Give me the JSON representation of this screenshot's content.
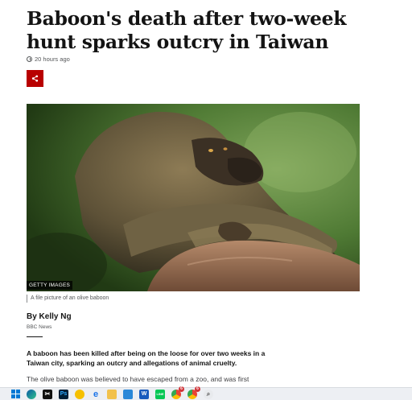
{
  "article": {
    "headline": "Baboon's death after two-week hunt sparks outcry in Taiwan",
    "timestamp": "20 hours ago",
    "share_icon": "share-icon",
    "image": {
      "credit": "GETTY IMAGES",
      "caption": "A file picture of an olive baboon"
    },
    "byline": {
      "author": "By Kelly Ng",
      "organization": "BBC News"
    },
    "lead_paragraph": "A baboon has been killed after being on the loose for over two weeks in a Taiwan city, sparking an outcry and allegations of animal cruelty.",
    "paragraph_2": "The olive baboon was believed to have escaped from a zoo, and was first"
  },
  "colors": {
    "brand_red": "#b80000",
    "text": "#141414",
    "muted": "#545658"
  },
  "taskbar": {
    "icons": [
      {
        "name": "windows-start-icon",
        "label": ""
      },
      {
        "name": "edge-browser-icon",
        "label": ""
      },
      {
        "name": "capcut-icon",
        "label": ""
      },
      {
        "name": "photoshop-icon",
        "label": "Ps"
      },
      {
        "name": "duck-app-icon",
        "label": ""
      },
      {
        "name": "ie-browser-icon",
        "label": "e"
      },
      {
        "name": "file-explorer-icon",
        "label": ""
      },
      {
        "name": "calendar-app-icon",
        "label": ""
      },
      {
        "name": "word-icon",
        "label": "W"
      },
      {
        "name": "line-app-icon",
        "label": "LINE"
      },
      {
        "name": "chrome-icon",
        "label": ""
      },
      {
        "name": "chrome-profile-icon",
        "label": ""
      },
      {
        "name": "search-app-icon",
        "label": ""
      }
    ],
    "badges": [
      "6",
      "6"
    ]
  }
}
